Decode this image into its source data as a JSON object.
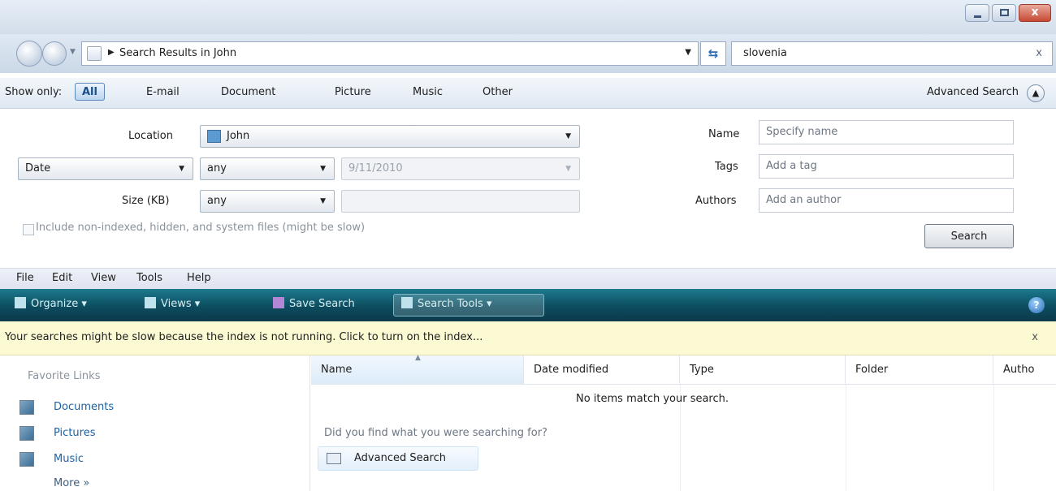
{
  "window": {
    "controls": {
      "close": "x"
    }
  },
  "nav": {
    "address": "Search Results in John",
    "search_value": "slovenia",
    "clear": "x"
  },
  "show_only": {
    "label": "Show only:",
    "filters": [
      "All",
      "E-mail",
      "Document",
      "Picture",
      "Music",
      "Other"
    ],
    "active": "All",
    "advanced_label": "Advanced Search"
  },
  "advanced": {
    "location_label": "Location",
    "location_value": "John",
    "date_type": "Date",
    "date_qualifier": "any",
    "date_value": "9/11/2010",
    "size_label": "Size (KB)",
    "size_qualifier": "any",
    "size_value": "",
    "include_label": "Include non-indexed, hidden, and system files (might be slow)",
    "name_label": "Name",
    "name_placeholder": "Specify name",
    "tags_label": "Tags",
    "tags_placeholder": "Add a tag",
    "authors_label": "Authors",
    "authors_placeholder": "Add an author",
    "search_button": "Search"
  },
  "menu": [
    "File",
    "Edit",
    "View",
    "Tools",
    "Help"
  ],
  "toolbar": {
    "organize": "Organize",
    "views": "Views",
    "save_search": "Save Search",
    "search_tools": "Search Tools",
    "help": "?"
  },
  "infobar": {
    "message": "Your searches might be slow because the index is not running.  Click to turn on the index...",
    "close": "x"
  },
  "favorites": {
    "title": "Favorite Links",
    "items": [
      "Documents",
      "Pictures",
      "Music"
    ],
    "more": "More"
  },
  "results": {
    "columns": [
      "Name",
      "Date modified",
      "Type",
      "Folder",
      "Autho"
    ],
    "empty_message": "No items match your search.",
    "prompt": "Did you find what you were searching for?",
    "advanced_link": "Advanced Search"
  }
}
